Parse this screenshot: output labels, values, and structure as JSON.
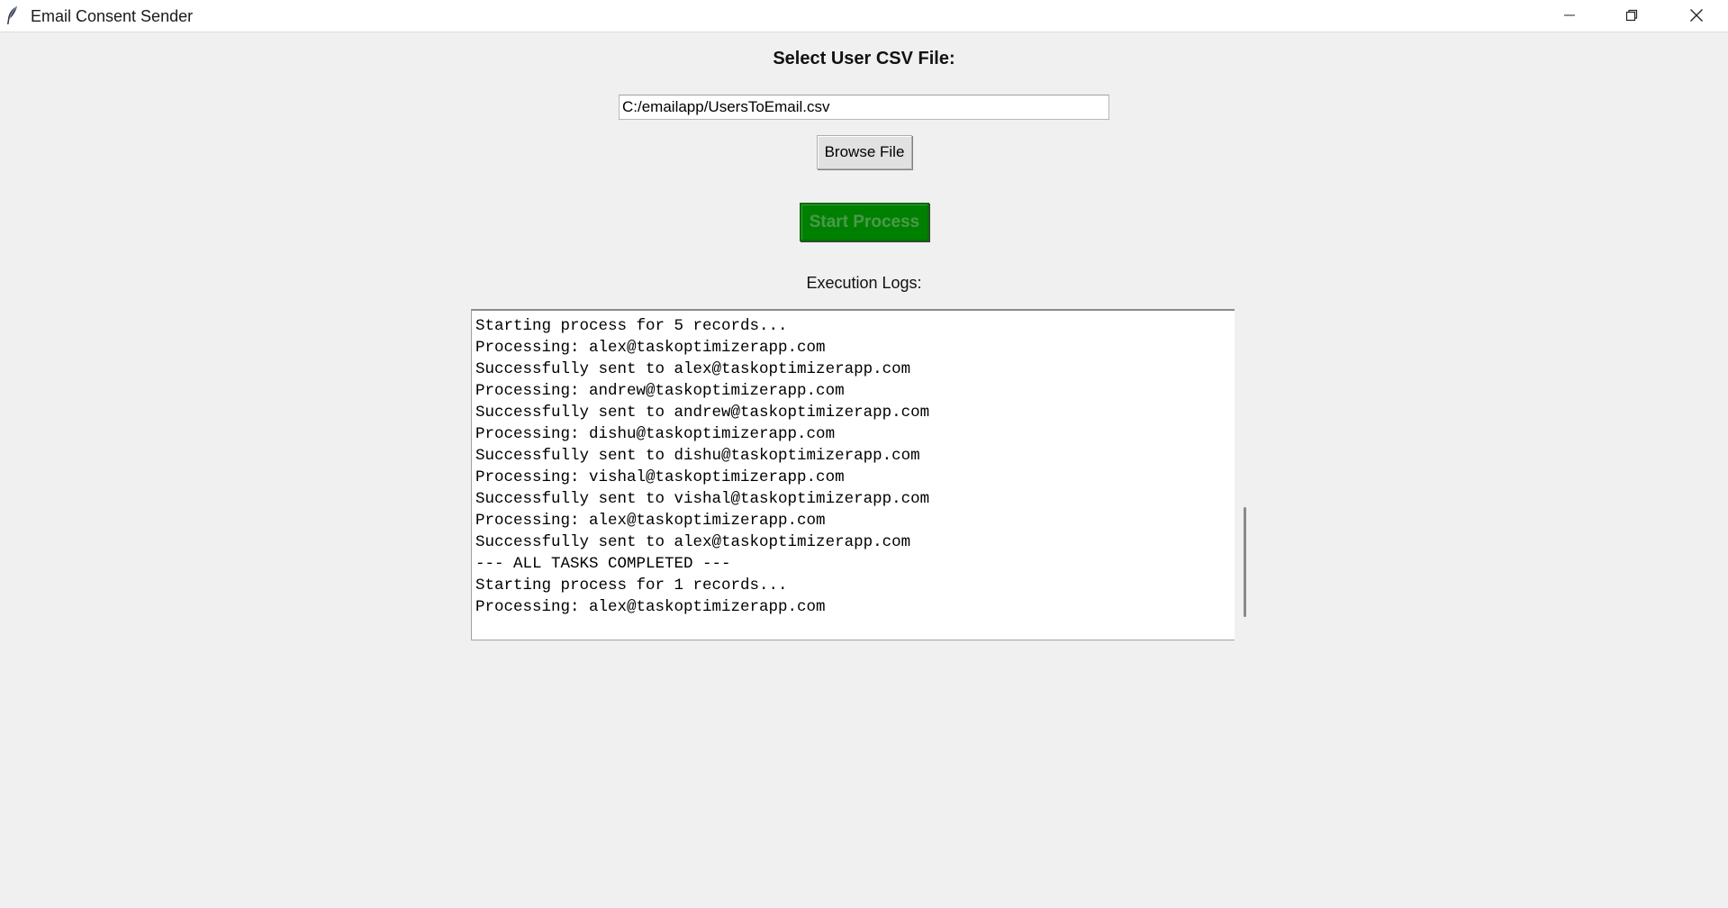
{
  "window": {
    "title": "Email Consent Sender",
    "icon": "feather-icon",
    "controls": {
      "minimize_icon": "minimize-icon",
      "maximize_icon": "restore-icon",
      "close_icon": "close-icon"
    }
  },
  "form": {
    "heading": "Select User CSV File:",
    "file_path_value": "C:/emailapp/UsersToEmail.csv",
    "browse_label": "Browse File",
    "start_label": "Start Process",
    "start_color": "#008000"
  },
  "logs": {
    "label": "Execution Logs:",
    "lines": [
      "Starting process for 5 records...",
      "Processing: alex@taskoptimizerapp.com",
      "Successfully sent to alex@taskoptimizerapp.com",
      "Processing: andrew@taskoptimizerapp.com",
      "Successfully sent to andrew@taskoptimizerapp.com",
      "Processing: dishu@taskoptimizerapp.com",
      "Successfully sent to dishu@taskoptimizerapp.com",
      "Processing: vishal@taskoptimizerapp.com",
      "Successfully sent to vishal@taskoptimizerapp.com",
      "Processing: alex@taskoptimizerapp.com",
      "Successfully sent to alex@taskoptimizerapp.com",
      "--- ALL TASKS COMPLETED ---",
      "Starting process for 1 records...",
      "Processing: alex@taskoptimizerapp.com"
    ]
  }
}
